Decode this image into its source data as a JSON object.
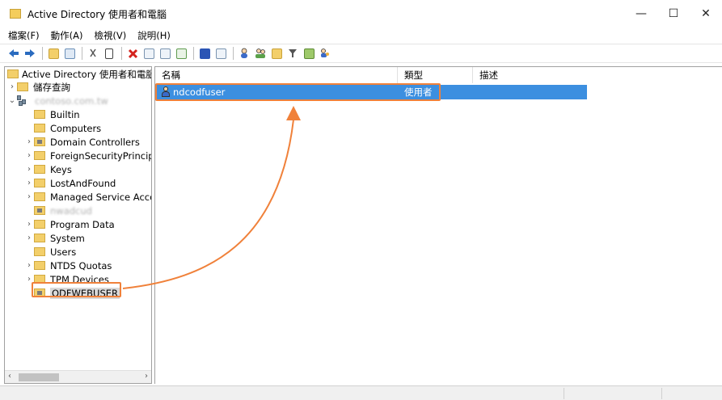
{
  "window": {
    "title": "Active Directory 使用者和電腦",
    "minimize_glyph": "—",
    "maximize_glyph": "☐",
    "close_glyph": "✕"
  },
  "menu": [
    "檔案(F)",
    "動作(A)",
    "檢視(V)",
    "說明(H)"
  ],
  "toolbar": {
    "icons": [
      "back-icon",
      "forward-icon",
      "up-folder-icon",
      "properties-pane-icon",
      "cut-icon",
      "copy-icon",
      "delete-icon",
      "properties-icon",
      "refresh-icon",
      "export-icon",
      "help-icon",
      "console-icon",
      "new-user-icon",
      "new-group-icon",
      "new-ou-icon",
      "filter-icon",
      "add-to-group-icon",
      "users-icon"
    ]
  },
  "tree": {
    "root_label": "Active Directory 使用者和電腦 [",
    "items": [
      {
        "label": "儲存查詢",
        "indent": 0,
        "expander": "›"
      },
      {
        "label": "contoso.com.tw",
        "indent": 0,
        "expander": "⌄",
        "blurred": true
      },
      {
        "label": "Builtin",
        "indent": 1,
        "expander": ""
      },
      {
        "label": "Computers",
        "indent": 1,
        "expander": ""
      },
      {
        "label": "Domain Controllers",
        "indent": 1,
        "expander": "›",
        "ou": true
      },
      {
        "label": "ForeignSecurityPrincipa",
        "indent": 1,
        "expander": "›"
      },
      {
        "label": "Keys",
        "indent": 1,
        "expander": "›"
      },
      {
        "label": "LostAndFound",
        "indent": 1,
        "expander": "›"
      },
      {
        "label": "Managed Service Acco",
        "indent": 1,
        "expander": "›"
      },
      {
        "label": "nwadcud",
        "indent": 1,
        "expander": "",
        "ou": true,
        "blurred": true
      },
      {
        "label": "Program Data",
        "indent": 1,
        "expander": "›"
      },
      {
        "label": "System",
        "indent": 1,
        "expander": "›"
      },
      {
        "label": "Users",
        "indent": 1,
        "expander": ""
      },
      {
        "label": "NTDS Quotas",
        "indent": 1,
        "expander": "›"
      },
      {
        "label": "TPM Devices",
        "indent": 1,
        "expander": "›"
      },
      {
        "label": "ODFWEBUSER",
        "indent": 1,
        "expander": "",
        "ou": true,
        "selected": true
      }
    ],
    "scroll_left": "‹",
    "scroll_right": "›"
  },
  "list": {
    "columns": [
      "名稱",
      "類型",
      "描述"
    ],
    "rows": [
      {
        "name": "ndcodfuser",
        "type": "使用者",
        "description": ""
      }
    ]
  },
  "colors": {
    "highlight_orange": "#f0813a",
    "selection_blue": "#3c8fe0",
    "folder_yellow": "#f3cf6a"
  }
}
